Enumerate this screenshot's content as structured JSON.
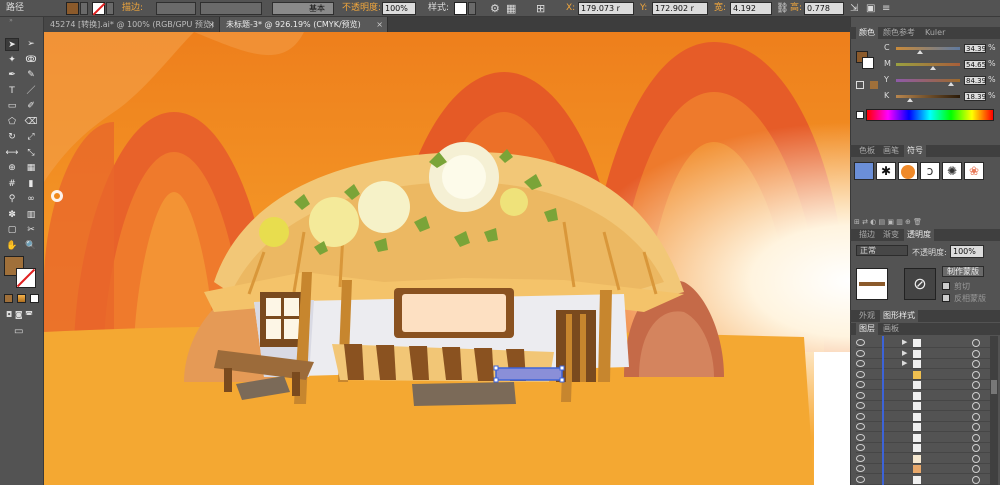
{
  "control_bar": {
    "path_label": "路径",
    "stroke_label": "描边:",
    "stroke_profile": "基本",
    "opacity_label": "不透明度:",
    "opacity_value": "100%",
    "style_label": "样式:",
    "x_label": "X:",
    "x_value": "179.073 r",
    "y_label": "Y:",
    "y_value": "172.902 r",
    "w_label": "宽:",
    "w_value": "4.192 mm",
    "h_label": "高:",
    "h_value": "0.778 mm",
    "fill_color": "#8b5a2b"
  },
  "tabs": [
    {
      "label": "45274 [转换].ai* @ 100% (RGB/GPU 预览)",
      "active": false
    },
    {
      "label": "未标题-3* @ 926.19% (CMYK/预览)",
      "active": true
    }
  ],
  "toolbar": {
    "tools": [
      "selection-tool",
      "direct-selection-tool",
      "magic-wand-tool",
      "lasso-tool",
      "pen-tool",
      "curvature-tool",
      "type-tool",
      "line-tool",
      "rectangle-tool",
      "paintbrush-tool",
      "shaper-tool",
      "eraser-tool",
      "rotate-tool",
      "scale-tool",
      "width-tool",
      "free-transform-tool",
      "shape-builder-tool",
      "perspective-grid-tool",
      "mesh-tool",
      "gradient-tool",
      "eyedropper-tool",
      "blend-tool",
      "symbol-sprayer-tool",
      "column-graph-tool",
      "artboard-tool",
      "slice-tool",
      "hand-tool",
      "zoom-tool"
    ],
    "fill_swatch": "#a0703a"
  },
  "color_panel": {
    "tabs": [
      "颜色",
      "颜色参考",
      "Kuler"
    ],
    "channels": [
      {
        "name": "C",
        "value": "34.39",
        "unit": "%"
      },
      {
        "name": "M",
        "value": "54.65",
        "unit": "%"
      },
      {
        "name": "Y",
        "value": "84.39",
        "unit": "%"
      },
      {
        "name": "K",
        "value": "18.39",
        "unit": "%"
      }
    ]
  },
  "swatch_panel": {
    "tabs": [
      "色板",
      "画笔",
      "符号"
    ]
  },
  "transparency_panel": {
    "tabs": [
      "描边",
      "渐变",
      "透明度"
    ],
    "blend_mode": "正常",
    "opacity_label": "不透明度:",
    "opacity_value": "100%",
    "make_mask_label": "制作蒙版",
    "clip_label": "剪切",
    "invert_mask_label": "反相蒙版"
  },
  "appearance_panel": {
    "tabs": [
      "外观",
      "图形样式"
    ]
  },
  "layers_panel": {
    "tabs": [
      "图层",
      "画板"
    ]
  },
  "colors": {
    "sky_top": "#f08a1c",
    "sky_mid": "#f5a12c",
    "ground": "#f4a832",
    "hill": "#e8582a",
    "thatch": "#f1c46e",
    "wood": "#7a4a1e",
    "wall": "#eeeef2"
  }
}
